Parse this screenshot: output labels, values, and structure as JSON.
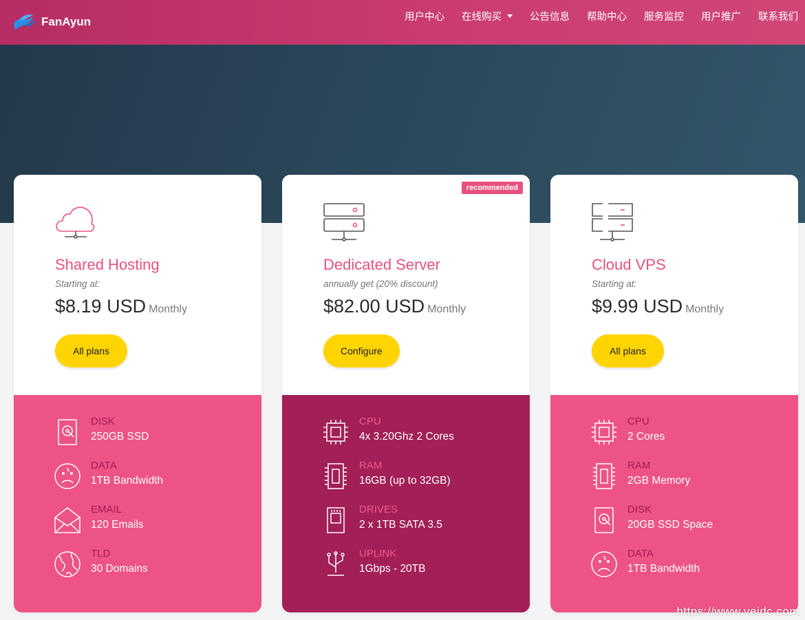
{
  "brand": {
    "name": "FanAyun",
    "logo_icon": "bird-logo-icon"
  },
  "nav": {
    "items": [
      {
        "label": "用户中心"
      },
      {
        "label": "在线购买",
        "has_dropdown": true
      },
      {
        "label": "公告信息"
      },
      {
        "label": "帮助中心"
      },
      {
        "label": "服务监控"
      },
      {
        "label": "用户推广"
      },
      {
        "label": "联系我们"
      }
    ]
  },
  "colors": {
    "accent_pink": "#e8527f",
    "card_pink": "#ee5385",
    "card_dark": "#a21f57",
    "button_yellow": "#ffd400",
    "hero": "#2c4a5c"
  },
  "plans": [
    {
      "icon": "cloud-icon",
      "title": "Shared Hosting",
      "subtitle": "Starting at:",
      "price": "$8.19 USD",
      "period": "Monthly",
      "button": "All plans",
      "features": [
        {
          "icon": "disk-icon",
          "label": "DISK",
          "value": "250GB SSD"
        },
        {
          "icon": "gauge-icon",
          "label": "DATA",
          "value": "1TB Bandwidth"
        },
        {
          "icon": "envelope-icon",
          "label": "EMAIL",
          "value": "120 Emails"
        },
        {
          "icon": "globe-icon",
          "label": "TLD",
          "value": "30 Domains"
        }
      ]
    },
    {
      "icon": "server-icon",
      "title": "Dedicated Server",
      "subtitle": "annually get (20% discount)",
      "price": "$82.00 USD",
      "period": "Monthly",
      "button": "Configure",
      "badge": "recommended",
      "features": [
        {
          "icon": "cpu-icon",
          "label": "CPU",
          "value": "4x 3.20Ghz 2 Cores"
        },
        {
          "icon": "ram-icon",
          "label": "RAM",
          "value": "16GB (up to 32GB)"
        },
        {
          "icon": "drive-icon",
          "label": "DRIVES",
          "value": "2 x 1TB SATA 3.5"
        },
        {
          "icon": "uplink-icon",
          "label": "UPLINK",
          "value": "1Gbps - 20TB"
        }
      ]
    },
    {
      "icon": "vps-server-icon",
      "title": "Cloud VPS",
      "subtitle": "Starting at:",
      "price": "$9.99 USD",
      "period": "Monthly",
      "button": "All plans",
      "features": [
        {
          "icon": "cpu-icon",
          "label": "CPU",
          "value": "2 Cores"
        },
        {
          "icon": "ram-icon",
          "label": "RAM",
          "value": "2GB Memory"
        },
        {
          "icon": "disk-icon",
          "label": "DISK",
          "value": "20GB SSD Space"
        },
        {
          "icon": "gauge-icon",
          "label": "DATA",
          "value": "1TB Bandwidth"
        }
      ]
    }
  ],
  "watermark": "https://www.veidc.com"
}
